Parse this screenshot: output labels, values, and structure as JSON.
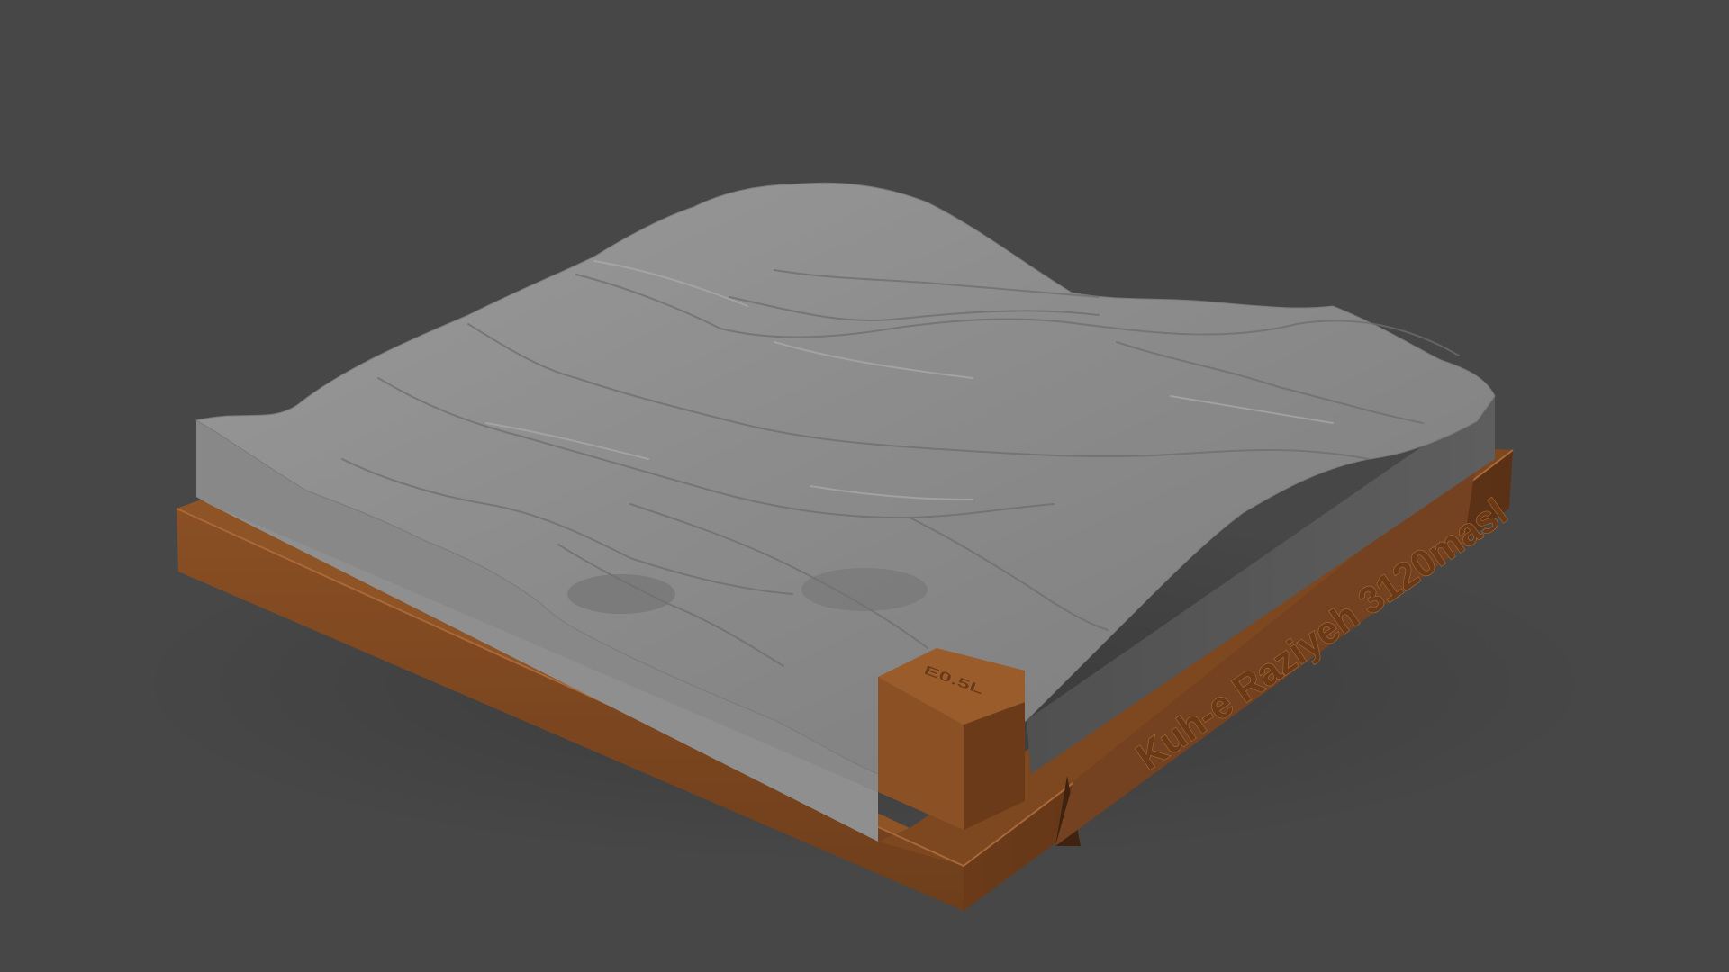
{
  "scene": {
    "background_color": "#474747",
    "subject": "terrain-relief-model",
    "terrain_color": "#8a8a8a",
    "base_color": "#7a4622"
  },
  "engravings": {
    "base_label": "Kuh-e Raziyeh 3120masl",
    "corner_block_label": "E0.5L"
  }
}
